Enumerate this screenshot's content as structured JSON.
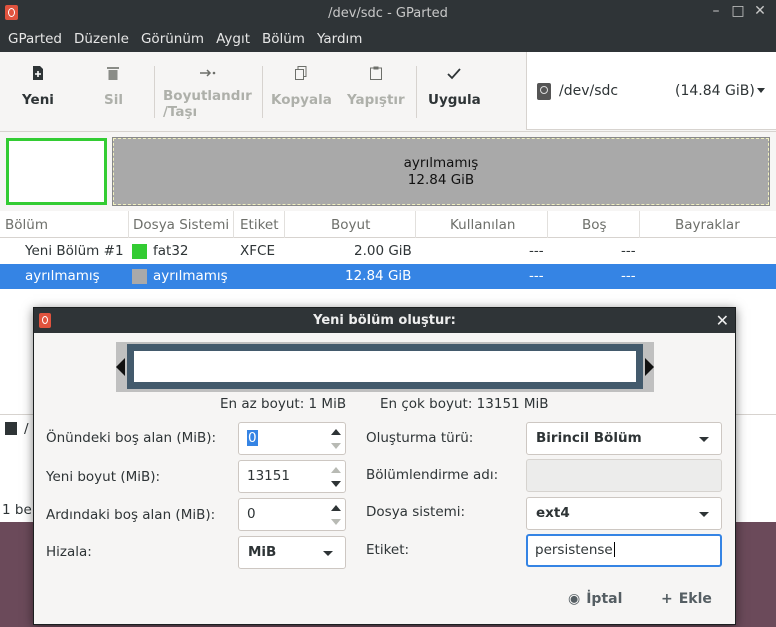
{
  "window": {
    "title": "/dev/sdc - GParted",
    "controls": {
      "minimize": "–",
      "maximize": "□",
      "close": "✕"
    }
  },
  "menu": [
    "GParted",
    "Düzenle",
    "Görünüm",
    "Aygıt",
    "Bölüm",
    "Yardım"
  ],
  "toolbar": {
    "new": {
      "icon": "new-icon",
      "label": "Yeni"
    },
    "delete": {
      "icon": "trash-icon",
      "label": "Sil"
    },
    "resize": {
      "icon": "resize-icon",
      "label_line1": "Boyutlandır",
      "label_line2": "/Taşı"
    },
    "copy": {
      "icon": "copy-icon",
      "label": "Kopyala"
    },
    "paste": {
      "icon": "paste-icon",
      "label": "Yapıştır"
    },
    "apply": {
      "icon": "check-icon",
      "label": "Uygula"
    }
  },
  "device": {
    "name": "/dev/sdc",
    "size": "(14.84 GiB)"
  },
  "diskmap": {
    "unallocated_label": "ayrılmamış",
    "unallocated_size": "12.84 GiB"
  },
  "table": {
    "headers": [
      "Bölüm",
      "Dosya Sistemi",
      "Etiket",
      "Boyut",
      "Kullanılan",
      "Boş",
      "Bayraklar"
    ],
    "rows": [
      {
        "partition": "Yeni Bölüm #1",
        "fs": "fat32",
        "fs_color": "#33cc33",
        "label": "XFCE",
        "size": "2.00 GiB",
        "used": "---",
        "free": "---",
        "flags": ""
      },
      {
        "partition": "ayrılmamış",
        "fs": "ayrılmamış",
        "fs_color": "#a9a9a9",
        "label": "",
        "size": "12.84 GiB",
        "used": "---",
        "free": "---",
        "flags": ""
      }
    ]
  },
  "bottom": {
    "partial_text": "/",
    "status": "1 bel"
  },
  "colors": {
    "accent": "#3584e4",
    "fat32": "#33cc33",
    "unallocated": "#a9a9a9",
    "titlebar": "#2f3437"
  },
  "dialog": {
    "title": "Yeni bölüm oluştur:",
    "close": "✕",
    "min_size": "En az boyut: 1 MiB",
    "max_size": "En çok boyut: 13151 MiB",
    "free_before_label": "Önündeki boş alan (MiB):",
    "free_before_value": "0",
    "new_size_label": "Yeni boyut (MiB):",
    "new_size_value": "13151",
    "free_after_label": "Ardındaki boş alan (MiB):",
    "free_after_value": "0",
    "align_label": "Hizala:",
    "align_value": "MiB",
    "create_as_label": "Oluşturma türü:",
    "create_as_value": "Birincil Bölüm",
    "partition_name_label": "Bölümlendirme adı:",
    "partition_name_value": "",
    "filesystem_label": "Dosya sistemi:",
    "filesystem_value": "ext4",
    "label_label": "Etiket:",
    "label_value": "persistense",
    "cancel": "İptal",
    "add": "Ekle"
  }
}
